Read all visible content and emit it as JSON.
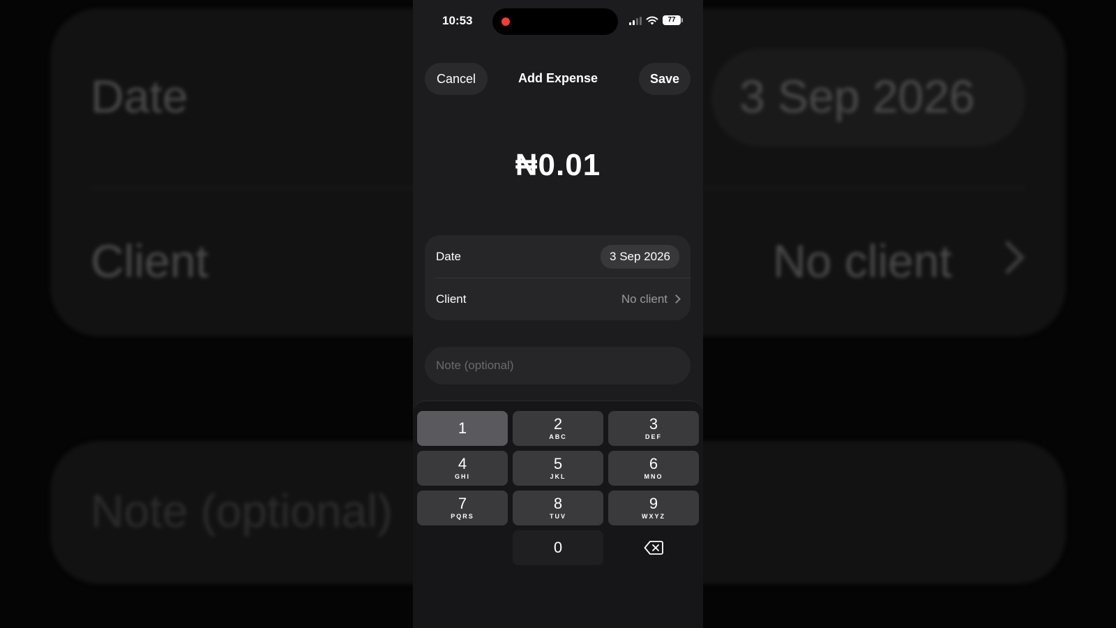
{
  "status_bar": {
    "time": "10:53",
    "battery": "77"
  },
  "header": {
    "cancel_label": "Cancel",
    "title": "Add Expense",
    "save_label": "Save"
  },
  "amount": "₦0.01",
  "form": {
    "date_label": "Date",
    "date_value": "3 Sep 2026",
    "client_label": "Client",
    "client_value": "No client"
  },
  "note": {
    "placeholder": "Note (optional)",
    "value": ""
  },
  "keypad": {
    "keys": [
      {
        "num": "1",
        "letters": ""
      },
      {
        "num": "2",
        "letters": "ABC"
      },
      {
        "num": "3",
        "letters": "DEF"
      },
      {
        "num": "4",
        "letters": "GHI"
      },
      {
        "num": "5",
        "letters": "JKL"
      },
      {
        "num": "6",
        "letters": "MNO"
      },
      {
        "num": "7",
        "letters": "PQRS"
      },
      {
        "num": "8",
        "letters": "TUV"
      },
      {
        "num": "9",
        "letters": "WXYZ"
      },
      {
        "num": "0",
        "letters": ""
      }
    ],
    "backspace_icon": "delete-left-icon"
  },
  "background": {
    "date_label": "Date",
    "date_value": "3 Sep 2026",
    "client_label": "Client",
    "client_value": "No client",
    "note_placeholder": "Note (optional)"
  },
  "colors": {
    "background": "#1c1c1e",
    "card": "#262628",
    "key": "#3a3a3c",
    "recording": "#ff3b30"
  }
}
